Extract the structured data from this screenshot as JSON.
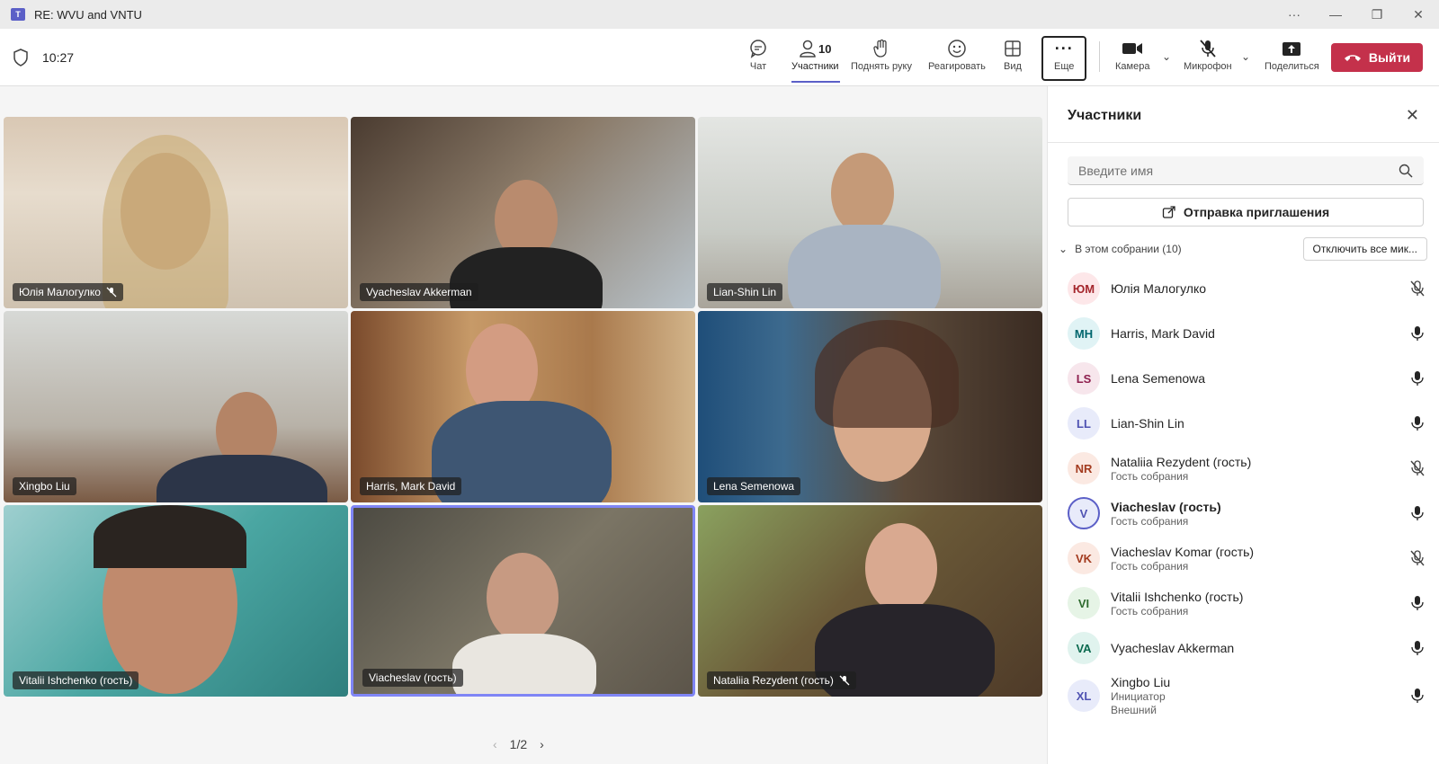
{
  "window": {
    "title": "RE: WVU and VNTU",
    "controls": [
      "···",
      "—",
      "❐",
      "✕"
    ]
  },
  "toolbar": {
    "time": "10:27",
    "chat": "Чат",
    "participants": "Участники",
    "participants_count": "10",
    "raise_hand": "Поднять руку",
    "react": "Реагировать",
    "view": "Вид",
    "more": "Еще",
    "camera": "Камера",
    "mic": "Микрофон",
    "share": "Поделиться",
    "leave": "Выйти"
  },
  "tiles": [
    {
      "name": "Юлія Малогулко",
      "muted": true
    },
    {
      "name": "Vyacheslav Akkerman",
      "muted": false
    },
    {
      "name": "Lian-Shin Lin",
      "muted": false
    },
    {
      "name": "Xingbo Liu",
      "muted": false
    },
    {
      "name": "Harris, Mark David",
      "muted": false
    },
    {
      "name": "Lena Semenowa",
      "muted": false
    },
    {
      "name": "Vitalii Ishchenko (гость)",
      "muted": false
    },
    {
      "name": "Viacheslav (гость)",
      "muted": false,
      "speaking": true
    },
    {
      "name": "Nataliia Rezydent (гость)",
      "muted": true
    }
  ],
  "pager": {
    "label": "1/2"
  },
  "panel": {
    "title": "Участники",
    "search_placeholder": "Введите имя",
    "invite": "Отправка приглашения",
    "section": "В этом собрании (10)",
    "mute_all": "Отключить все мик...",
    "participants": [
      {
        "initials": "ЮМ",
        "name": "Юлія Малогулко",
        "role": "",
        "muted": true,
        "color": "#fde7e9",
        "fg": "#a4262c"
      },
      {
        "initials": "MH",
        "name": "Harris, Mark David",
        "role": "",
        "muted": false,
        "color": "#e0f3f5",
        "fg": "#00666d"
      },
      {
        "initials": "LS",
        "name": "Lena Semenowa",
        "role": "",
        "muted": false,
        "color": "#f7e6ec",
        "fg": "#8e1f4e"
      },
      {
        "initials": "LL",
        "name": "Lian-Shin Lin",
        "role": "",
        "muted": false,
        "color": "#e8ebfa",
        "fg": "#4f52b2"
      },
      {
        "initials": "NR",
        "name": "Nataliia Rezydent (гость)",
        "role": "Гость собрания",
        "muted": true,
        "color": "#fbe9e2",
        "fg": "#a33b1f"
      },
      {
        "initials": "V",
        "name": "Viacheslav (гость)",
        "role": "Гость собрания",
        "muted": false,
        "self": true,
        "color": "#e8ebfa",
        "fg": "#4f52b2"
      },
      {
        "initials": "VK",
        "name": "Viacheslav Komar (гость)",
        "role": "Гость собрания",
        "muted": true,
        "color": "#fbe9e2",
        "fg": "#a33b1f"
      },
      {
        "initials": "VI",
        "name": "Vitalii Ishchenko (гость)",
        "role": "Гость собрания",
        "muted": false,
        "color": "#e6f4e6",
        "fg": "#2e6b2e"
      },
      {
        "initials": "VA",
        "name": "Vyacheslav Akkerman",
        "role": "",
        "muted": false,
        "color": "#e0f3ee",
        "fg": "#0b6a4f"
      },
      {
        "initials": "XL",
        "name": "Xingbo Liu",
        "role": "Инициатор",
        "role2": "Внешний",
        "muted": false,
        "color": "#e8ebfa",
        "fg": "#4f52b2"
      }
    ]
  }
}
